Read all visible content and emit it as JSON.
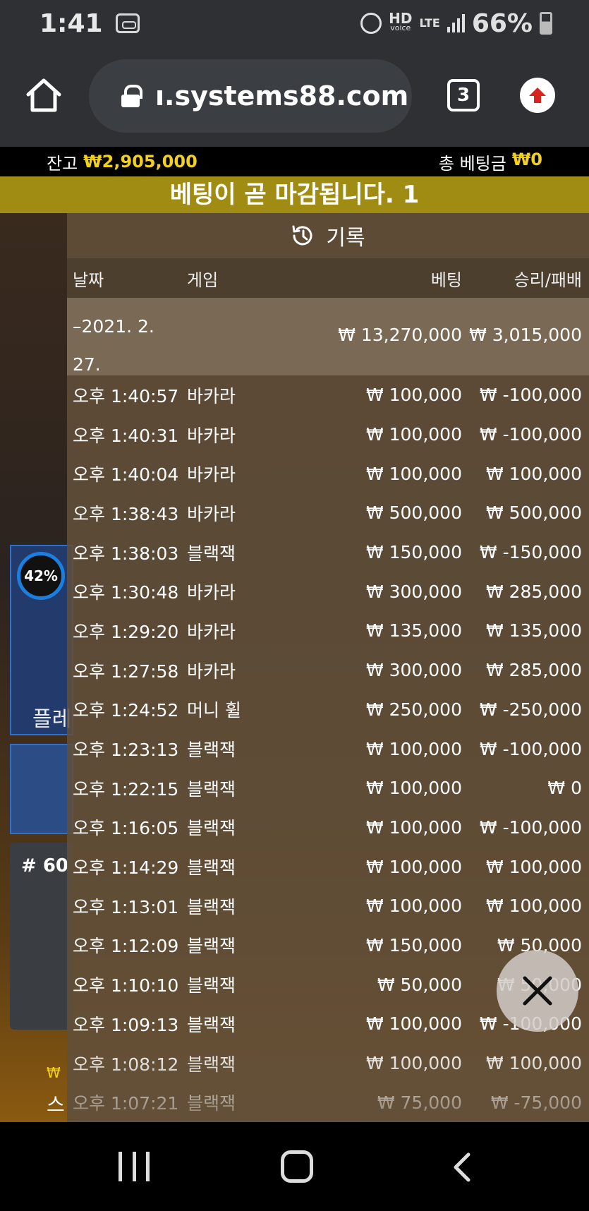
{
  "status_bar": {
    "time": "1:41",
    "hd_label": "HD",
    "hd_sub": "voice",
    "lte_label": "LTE",
    "battery": "66%"
  },
  "browser": {
    "url": "ı.systems88.com",
    "tab_count": "3"
  },
  "balance_bar": {
    "balance_label": "잔고",
    "balance_value": "₩2,905,000",
    "total_bet_label": "총 베팅금",
    "total_bet_value": "₩0"
  },
  "notice": "베팅이 곧 마감됩니다. 1",
  "background": {
    "percent": "42%",
    "label": "플레",
    "hash": "# 60",
    "s_label": "스"
  },
  "history": {
    "title": "기록",
    "columns": {
      "date": "날짜",
      "game": "게임",
      "bet": "베팅",
      "win_loss": "승리/패배"
    },
    "summary": {
      "date": "–2021. 2. 27.",
      "bet": "₩ 13,270,000",
      "win_loss": "₩ 3,015,000"
    },
    "rows": [
      {
        "time": "오후 1:40:57",
        "game": "바카라",
        "bet": "₩ 100,000",
        "result": "₩ -100,000"
      },
      {
        "time": "오후 1:40:31",
        "game": "바카라",
        "bet": "₩ 100,000",
        "result": "₩ -100,000"
      },
      {
        "time": "오후 1:40:04",
        "game": "바카라",
        "bet": "₩ 100,000",
        "result": "₩ 100,000"
      },
      {
        "time": "오후 1:38:43",
        "game": "바카라",
        "bet": "₩ 500,000",
        "result": "₩ 500,000"
      },
      {
        "time": "오후 1:38:03",
        "game": "블랙잭",
        "bet": "₩ 150,000",
        "result": "₩ -150,000"
      },
      {
        "time": "오후 1:30:48",
        "game": "바카라",
        "bet": "₩ 300,000",
        "result": "₩ 285,000"
      },
      {
        "time": "오후 1:29:20",
        "game": "바카라",
        "bet": "₩ 135,000",
        "result": "₩ 135,000"
      },
      {
        "time": "오후 1:27:58",
        "game": "바카라",
        "bet": "₩ 300,000",
        "result": "₩ 285,000"
      },
      {
        "time": "오후 1:24:52",
        "game": "머니 휠",
        "bet": "₩ 250,000",
        "result": "₩ -250,000"
      },
      {
        "time": "오후 1:23:13",
        "game": "블랙잭",
        "bet": "₩ 100,000",
        "result": "₩ -100,000"
      },
      {
        "time": "오후 1:22:15",
        "game": "블랙잭",
        "bet": "₩ 100,000",
        "result": "₩ 0"
      },
      {
        "time": "오후 1:16:05",
        "game": "블랙잭",
        "bet": "₩ 100,000",
        "result": "₩ -100,000"
      },
      {
        "time": "오후 1:14:29",
        "game": "블랙잭",
        "bet": "₩ 100,000",
        "result": "₩ 100,000"
      },
      {
        "time": "오후 1:13:01",
        "game": "블랙잭",
        "bet": "₩ 100,000",
        "result": "₩ 100,000"
      },
      {
        "time": "오후 1:12:09",
        "game": "블랙잭",
        "bet": "₩ 150,000",
        "result": "₩ 50,000"
      },
      {
        "time": "오후 1:10:10",
        "game": "블랙잭",
        "bet": "₩ 50,000",
        "result": "₩ 50,000"
      },
      {
        "time": "오후 1:09:13",
        "game": "블랙잭",
        "bet": "₩ 100,000",
        "result": "₩ -100,000"
      },
      {
        "time": "오후 1:08:12",
        "game": "블랙잭",
        "bet": "₩ 100,000",
        "result": "₩ 100,000"
      },
      {
        "time": "오후 1:07:21",
        "game": "블랙잭",
        "bet": "₩ 75,000",
        "result": "₩ -75,000"
      }
    ]
  },
  "colors": {
    "accent_yellow": "#f2d11e",
    "notice_bg": "#a08c12",
    "panel_bg": "#62503a"
  }
}
